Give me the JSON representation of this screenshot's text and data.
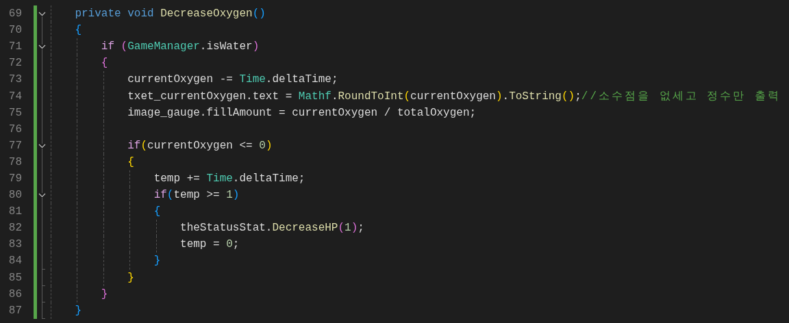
{
  "editor": {
    "lines": [
      {
        "number": "69",
        "changed": true,
        "fold": true,
        "fold_end": false,
        "tokens": [
          {
            "kind": "keyword",
            "text": "    private void"
          },
          {
            "kind": "method",
            "text": " DecreaseOxygen"
          },
          {
            "kind": "brace1",
            "text": "()"
          }
        ]
      },
      {
        "number": "70",
        "changed": true,
        "fold": false,
        "fold_end": false,
        "tokens": [
          {
            "kind": "brace1",
            "text": "    {"
          }
        ]
      },
      {
        "number": "71",
        "changed": true,
        "fold": true,
        "fold_end": false,
        "tokens": [
          {
            "kind": "control",
            "text": "        if"
          },
          {
            "kind": "brace2",
            "text": " ("
          },
          {
            "kind": "type",
            "text": "GameManager"
          },
          {
            "kind": "plain",
            "text": ".isWater"
          },
          {
            "kind": "brace2",
            "text": ")"
          }
        ]
      },
      {
        "number": "72",
        "changed": true,
        "fold": false,
        "fold_end": false,
        "tokens": [
          {
            "kind": "brace2",
            "text": "        {"
          }
        ]
      },
      {
        "number": "73",
        "changed": true,
        "fold": false,
        "fold_end": false,
        "tokens": [
          {
            "kind": "plain",
            "text": "            currentOxygen -= "
          },
          {
            "kind": "type",
            "text": "Time"
          },
          {
            "kind": "plain",
            "text": ".deltaTime;"
          }
        ]
      },
      {
        "number": "74",
        "changed": true,
        "fold": false,
        "fold_end": false,
        "tokens": [
          {
            "kind": "plain",
            "text": "            txet_currentOxygen.text = "
          },
          {
            "kind": "type",
            "text": "Mathf"
          },
          {
            "kind": "plain",
            "text": "."
          },
          {
            "kind": "method",
            "text": "RoundToInt"
          },
          {
            "kind": "brace3",
            "text": "("
          },
          {
            "kind": "plain",
            "text": "currentOxygen"
          },
          {
            "kind": "brace3",
            "text": ")"
          },
          {
            "kind": "plain",
            "text": "."
          },
          {
            "kind": "method",
            "text": "ToString"
          },
          {
            "kind": "brace3",
            "text": "()"
          },
          {
            "kind": "plain",
            "text": ";"
          },
          {
            "kind": "comment",
            "text": "//소수점을 없세고 정수만 출력"
          }
        ]
      },
      {
        "number": "75",
        "changed": true,
        "fold": false,
        "fold_end": false,
        "tokens": [
          {
            "kind": "plain",
            "text": "            image_gauge.fillAmount = currentOxygen / totalOxygen;"
          }
        ]
      },
      {
        "number": "76",
        "changed": true,
        "fold": false,
        "fold_end": false
      },
      {
        "number": "77",
        "changed": true,
        "fold": true,
        "fold_end": false,
        "tokens": [
          {
            "kind": "control",
            "text": "            if"
          },
          {
            "kind": "brace3",
            "text": "("
          },
          {
            "kind": "plain",
            "text": "currentOxygen <= "
          },
          {
            "kind": "number",
            "text": "0"
          },
          {
            "kind": "brace3",
            "text": ")"
          }
        ]
      },
      {
        "number": "78",
        "changed": true,
        "fold": false,
        "fold_end": false,
        "tokens": [
          {
            "kind": "brace3",
            "text": "            {"
          }
        ]
      },
      {
        "number": "79",
        "changed": true,
        "fold": false,
        "fold_end": false,
        "tokens": [
          {
            "kind": "plain",
            "text": "                temp += "
          },
          {
            "kind": "type",
            "text": "Time"
          },
          {
            "kind": "plain",
            "text": ".deltaTime;"
          }
        ]
      },
      {
        "number": "80",
        "changed": true,
        "fold": true,
        "fold_end": false,
        "tokens": [
          {
            "kind": "control",
            "text": "                if"
          },
          {
            "kind": "brace1",
            "text": "("
          },
          {
            "kind": "plain",
            "text": "temp >= "
          },
          {
            "kind": "number",
            "text": "1"
          },
          {
            "kind": "brace1",
            "text": ")"
          }
        ]
      },
      {
        "number": "81",
        "changed": true,
        "fold": false,
        "fold_end": false,
        "tokens": [
          {
            "kind": "brace1",
            "text": "                {"
          }
        ]
      },
      {
        "number": "82",
        "changed": true,
        "fold": false,
        "fold_end": false,
        "tokens": [
          {
            "kind": "plain",
            "text": "                    theStatusStat."
          },
          {
            "kind": "method",
            "text": "DecreaseHP"
          },
          {
            "kind": "brace2",
            "text": "("
          },
          {
            "kind": "number",
            "text": "1"
          },
          {
            "kind": "brace2",
            "text": ")"
          },
          {
            "kind": "plain",
            "text": ";"
          }
        ]
      },
      {
        "number": "83",
        "changed": true,
        "fold": false,
        "fold_end": false,
        "tokens": [
          {
            "kind": "plain",
            "text": "                    temp = "
          },
          {
            "kind": "number",
            "text": "0"
          },
          {
            "kind": "plain",
            "text": ";"
          }
        ]
      },
      {
        "number": "84",
        "changed": true,
        "fold": false,
        "fold_end": true,
        "tokens": [
          {
            "kind": "brace1",
            "text": "                }"
          }
        ]
      },
      {
        "number": "85",
        "changed": true,
        "fold": false,
        "fold_end": true,
        "tokens": [
          {
            "kind": "brace3",
            "text": "            }"
          }
        ]
      },
      {
        "number": "86",
        "changed": true,
        "fold": false,
        "fold_end": true,
        "tokens": [
          {
            "kind": "brace2",
            "text": "        }"
          }
        ]
      },
      {
        "number": "87",
        "changed": true,
        "fold": false,
        "fold_end": true,
        "tokens": [
          {
            "kind": "brace1",
            "text": "    }"
          }
        ]
      }
    ]
  }
}
